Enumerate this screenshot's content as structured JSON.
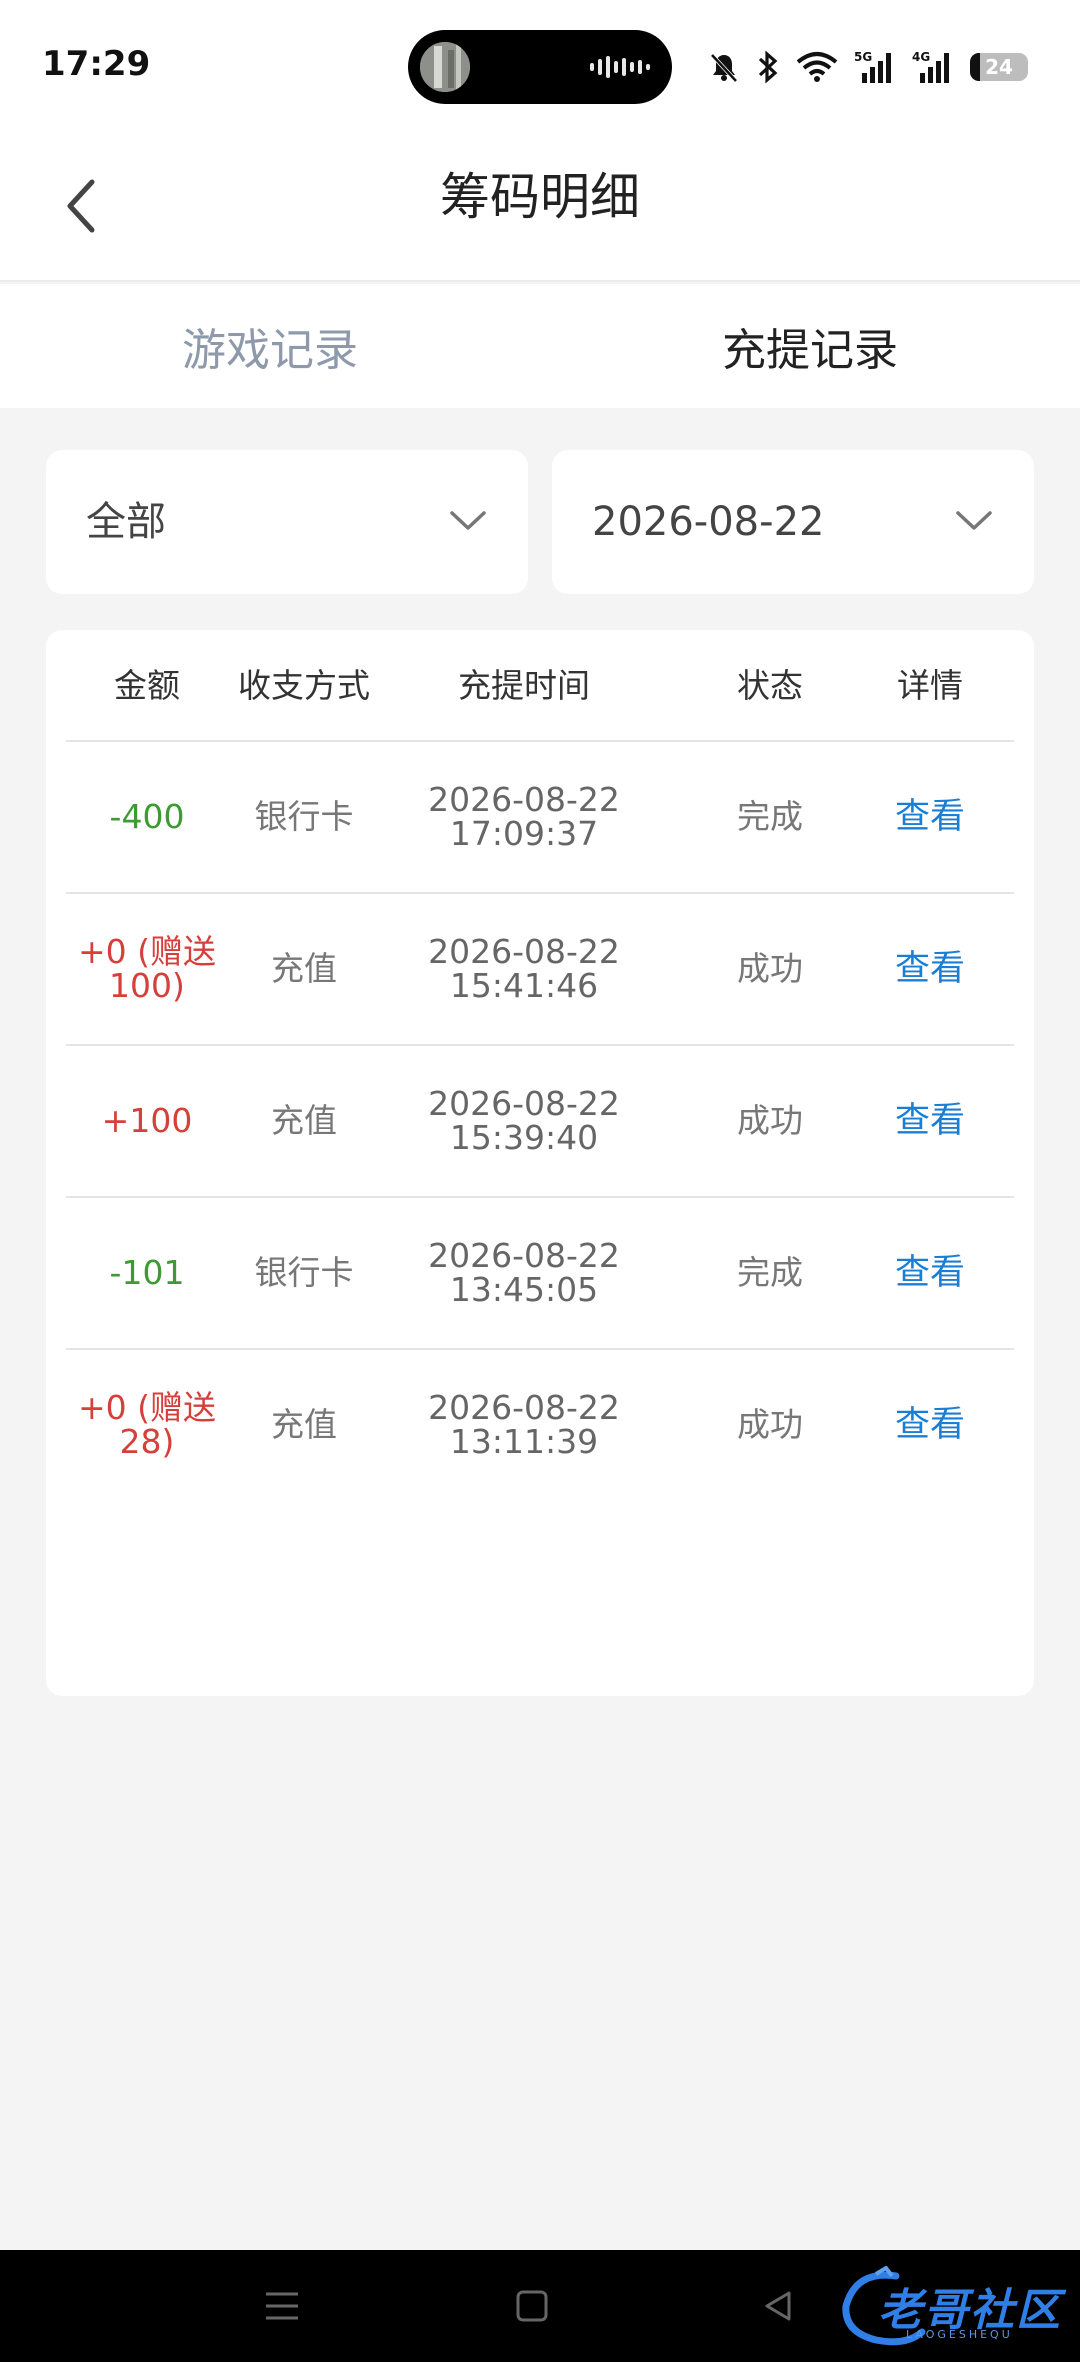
{
  "status_bar": {
    "time": "17:29",
    "battery": "24",
    "network_1": "5G",
    "network_2": "4G"
  },
  "header": {
    "title": "筹码明细"
  },
  "tabs": [
    {
      "label": "游戏记录",
      "active": false
    },
    {
      "label": "充提记录",
      "active": true
    }
  ],
  "filters": {
    "type": "全部",
    "date": "2026-08-22"
  },
  "table": {
    "columns": [
      "金额",
      "收支方式",
      "充提时间",
      "状态",
      "详情"
    ],
    "rows": [
      {
        "amount_1": "-400",
        "amount_2": "",
        "method": "银行卡",
        "date": "2026-08-22",
        "time": "17:09:37",
        "status": "完成",
        "detail": "查看"
      },
      {
        "amount_1": "+0 (赠送",
        "amount_2": "100)",
        "method": "充值",
        "date": "2026-08-22",
        "time": "15:41:46",
        "status": "成功",
        "detail": "查看"
      },
      {
        "amount_1": "+100",
        "amount_2": "",
        "method": "充值",
        "date": "2026-08-22",
        "time": "15:39:40",
        "status": "成功",
        "detail": "查看"
      },
      {
        "amount_1": "-101",
        "amount_2": "",
        "method": "银行卡",
        "date": "2026-08-22",
        "time": "13:45:05",
        "status": "完成",
        "detail": "查看"
      },
      {
        "amount_1": "+0 (赠送",
        "amount_2": "28)",
        "method": "充值",
        "date": "2026-08-22",
        "time": "13:11:39",
        "status": "成功",
        "detail": "查看"
      }
    ]
  },
  "watermark": {
    "text": "老哥社区",
    "sub": "LAOGESHEQU"
  },
  "colors": {
    "negative_amount": "#3f9a34",
    "positive_amount": "#d6403b",
    "link": "#1a7fd4",
    "inactive_tab": "#8e9aac"
  }
}
